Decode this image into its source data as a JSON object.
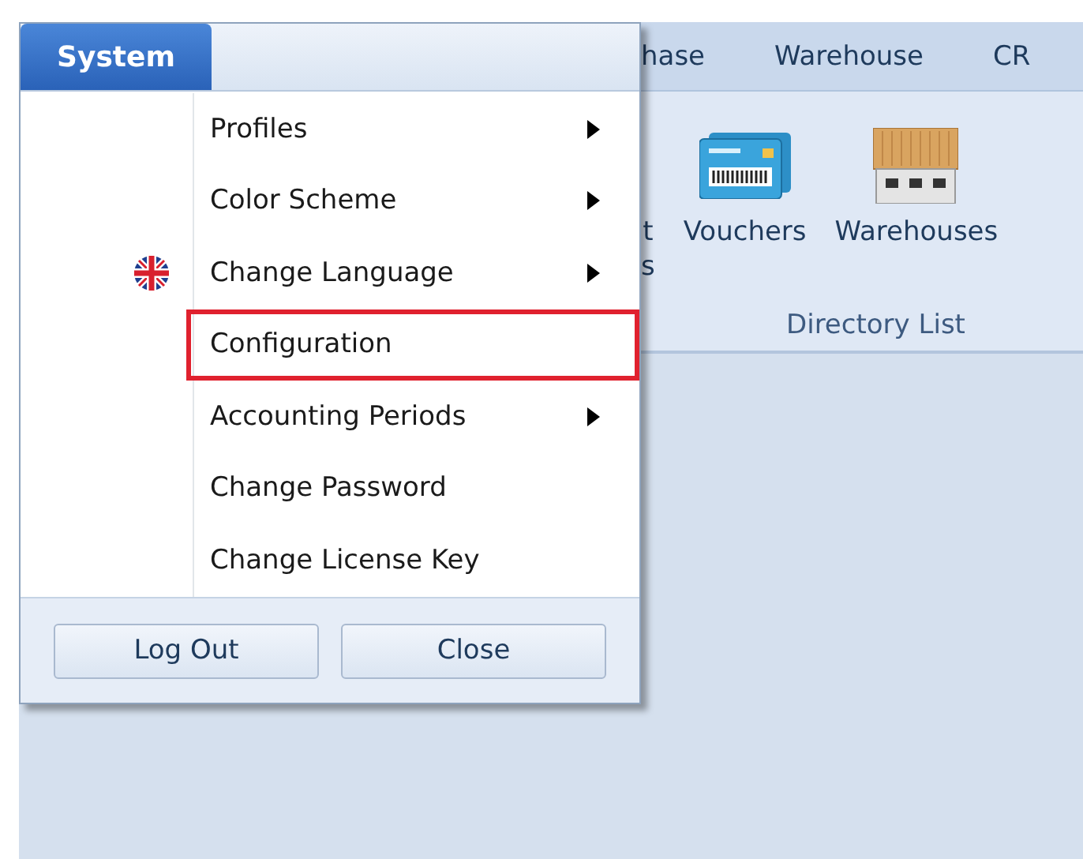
{
  "ribbon": {
    "tabs": [
      {
        "label": "hase"
      },
      {
        "label": "Warehouse"
      },
      {
        "label": "CR"
      }
    ],
    "group": {
      "items": [
        {
          "lines": [
            "t",
            "s"
          ],
          "kind": "partial"
        },
        {
          "lines": [
            "Vouchers"
          ],
          "kind": "voucher"
        },
        {
          "lines": [
            "Warehouses"
          ],
          "kind": "warehouse"
        }
      ],
      "label": "Directory List"
    }
  },
  "menu": {
    "tab": "System",
    "items": [
      {
        "label": "Profiles",
        "submenu": true,
        "icon": false,
        "selected": false
      },
      {
        "label": "Color Scheme",
        "submenu": true,
        "icon": false,
        "selected": false
      },
      {
        "label": "Change Language",
        "submenu": true,
        "icon": true,
        "selected": false
      },
      {
        "label": "Configuration",
        "submenu": false,
        "icon": false,
        "selected": true
      },
      {
        "label": "Accounting Periods",
        "submenu": true,
        "icon": false,
        "selected": false
      },
      {
        "label": "Change Password",
        "submenu": false,
        "icon": false,
        "selected": false
      },
      {
        "label": "Change License Key",
        "submenu": false,
        "icon": false,
        "selected": false
      }
    ],
    "buttons": [
      "Log Out",
      "Close"
    ]
  }
}
